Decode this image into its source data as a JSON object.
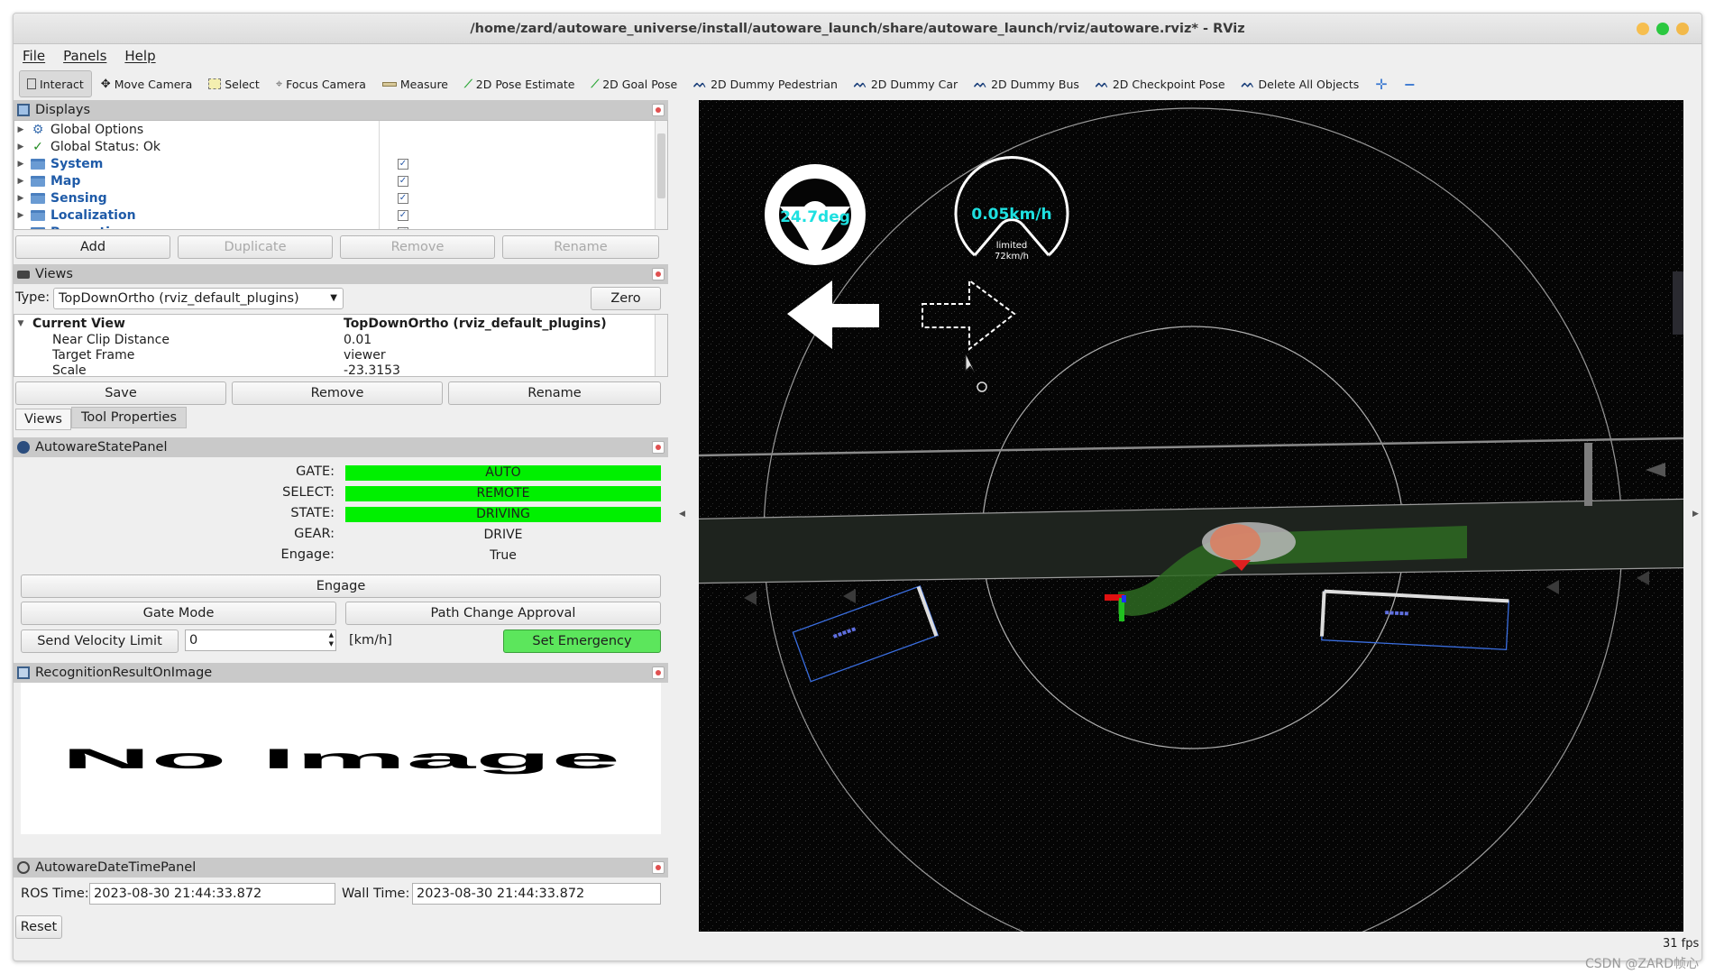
{
  "window": {
    "title": "/home/zard/autoware_universe/install/autoware_launch/share/autoware_launch/rviz/autoware.rviz* - RViz",
    "controls": {
      "min_color": "#f6be4f",
      "max_color": "#2bc840",
      "close_color": "#f2b94a"
    }
  },
  "menu": {
    "file": "File",
    "panels": "Panels",
    "help": "Help"
  },
  "toolbar": {
    "interact": "Interact",
    "move_camera": "Move Camera",
    "select": "Select",
    "focus_camera": "Focus Camera",
    "measure": "Measure",
    "pose_estimate": "2D Pose Estimate",
    "goal_pose": "2D Goal Pose",
    "dummy_pedestrian": "2D Dummy Pedestrian",
    "dummy_car": "2D Dummy Car",
    "dummy_bus": "2D Dummy Bus",
    "checkpoint_pose": "2D Checkpoint Pose",
    "delete_all": "Delete All Objects"
  },
  "displays": {
    "title": "Displays",
    "items": [
      {
        "label": "Global Options",
        "style": "plain",
        "checked": null
      },
      {
        "label": "Global Status: Ok",
        "style": "plain",
        "checked": null
      },
      {
        "label": "System",
        "style": "folder",
        "checked": true
      },
      {
        "label": "Map",
        "style": "folder",
        "checked": true
      },
      {
        "label": "Sensing",
        "style": "folder",
        "checked": true
      },
      {
        "label": "Localization",
        "style": "folder",
        "checked": true
      },
      {
        "label": "Perception",
        "style": "folder",
        "checked": true
      }
    ],
    "buttons": {
      "add": "Add",
      "duplicate": "Duplicate",
      "remove": "Remove",
      "rename": "Rename"
    }
  },
  "views": {
    "title": "Views",
    "type_label": "Type:",
    "type_value": "TopDownOrtho (rviz_default_plugins)",
    "zero": "Zero",
    "current_view": {
      "label": "Current View",
      "value": "TopDownOrtho (rviz_default_plugins)"
    },
    "props": [
      {
        "name": "Near Clip Distance",
        "value": "0.01"
      },
      {
        "name": "Target Frame",
        "value": "viewer"
      },
      {
        "name": "Scale",
        "value": "-23.3153"
      }
    ],
    "buttons": {
      "save": "Save",
      "remove": "Remove",
      "rename": "Rename"
    },
    "tabs": {
      "views": "Views",
      "tool_properties": "Tool Properties"
    }
  },
  "state_panel": {
    "title": "AutowareStatePanel",
    "rows": [
      {
        "label": "GATE:",
        "value": "AUTO",
        "highlight": true
      },
      {
        "label": "SELECT:",
        "value": "REMOTE",
        "highlight": true
      },
      {
        "label": "STATE:",
        "value": "DRIVING",
        "highlight": true
      },
      {
        "label": "GEAR:",
        "value": "DRIVE",
        "highlight": false
      },
      {
        "label": "Engage:",
        "value": "True",
        "highlight": false
      }
    ],
    "engage": "Engage",
    "gate_mode": "Gate Mode",
    "path_change": "Path Change Approval",
    "send_velocity": "Send Velocity Limit",
    "velocity_value": "0",
    "unit": "[km/h]",
    "set_emergency": "Set Emergency",
    "green": "#00f000"
  },
  "recognition": {
    "title": "RecognitionResultOnImage",
    "no_image": "No Image"
  },
  "datetime": {
    "title": "AutowareDateTimePanel",
    "ros_label": "ROS Time:",
    "ros_value": "2023-08-30 21:44:33.872",
    "wall_label": "Wall Time:",
    "wall_value": "2023-08-30 21:44:33.872",
    "reset": "Reset"
  },
  "viewport": {
    "steering": "24.7deg",
    "speed": "0.05km/h",
    "limit_line1": "limited",
    "limit_line2": "72km/h",
    "fps": "31 fps",
    "accent": "#1ee0e0"
  },
  "watermark": "CSDN @ZARD帧心"
}
